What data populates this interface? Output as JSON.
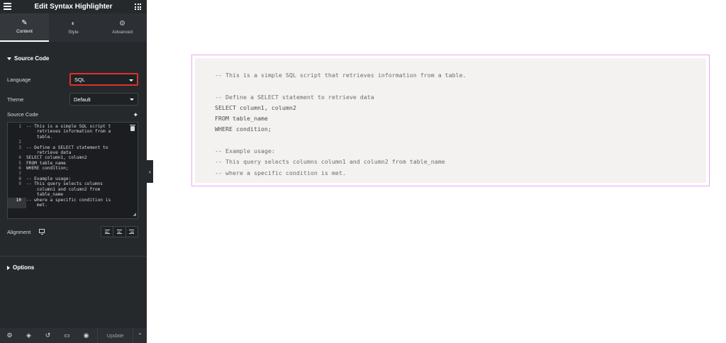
{
  "header": {
    "title": "Edit Syntax Highlighter"
  },
  "tabs": [
    {
      "label": "Content",
      "icon": "pencil-icon",
      "active": true
    },
    {
      "label": "Style",
      "icon": "half-circle-icon",
      "active": false
    },
    {
      "label": "Advanced",
      "icon": "gear-icon",
      "active": false
    }
  ],
  "source_section": {
    "title": "Source Code"
  },
  "language": {
    "label": "Language",
    "value": "SQL"
  },
  "theme": {
    "label": "Theme",
    "value": "Default"
  },
  "source_code": {
    "label": "Source Code",
    "lines": [
      {
        "num": "1",
        "text": "-- This is a simple SQL script t"
      },
      {
        "num": "",
        "text": "    retrieves information from a"
      },
      {
        "num": "",
        "text": "    table."
      },
      {
        "num": "2",
        "text": ""
      },
      {
        "num": "3",
        "text": "-- Define a SELECT statement to"
      },
      {
        "num": "",
        "text": "    retrieve data"
      },
      {
        "num": "4",
        "text": "SELECT column1, column2"
      },
      {
        "num": "5",
        "text": "FROM table_name"
      },
      {
        "num": "6",
        "text": "WHERE condition;"
      },
      {
        "num": "7",
        "text": ""
      },
      {
        "num": "8",
        "text": "-- Example usage:"
      },
      {
        "num": "9",
        "text": "-- This query selects columns"
      },
      {
        "num": "",
        "text": "    column1 and column2 from"
      },
      {
        "num": "",
        "text": "    table_name"
      },
      {
        "num": "10",
        "text": "-- where a specific condition is"
      },
      {
        "num": "",
        "text": "    met."
      }
    ]
  },
  "alignment": {
    "label": "Alignment"
  },
  "options_section": {
    "title": "Options"
  },
  "footer": {
    "update_label": "Update"
  },
  "collapse": {
    "glyph": "‹"
  },
  "preview": {
    "lines": [
      {
        "text": "-- This is a simple SQL script that retrieves information from a table.",
        "kind": "comment"
      },
      {
        "text": "",
        "kind": "code"
      },
      {
        "text": "-- Define a SELECT statement to retrieve data",
        "kind": "comment"
      },
      {
        "text": "SELECT column1, column2",
        "kind": "code"
      },
      {
        "text": "FROM table_name",
        "kind": "code"
      },
      {
        "text": "WHERE condition;",
        "kind": "code"
      },
      {
        "text": "",
        "kind": "code"
      },
      {
        "text": "-- Example usage:",
        "kind": "comment"
      },
      {
        "text": "-- This query selects columns column1 and column2 from table_name",
        "kind": "comment"
      },
      {
        "text": "-- where a specific condition is met.",
        "kind": "comment"
      }
    ]
  },
  "colors": {
    "sidebar_bg": "#26292c",
    "highlight_border": "#d9342b",
    "preview_border": "#e9a5ee",
    "preview_bg": "#f3f2f0"
  }
}
